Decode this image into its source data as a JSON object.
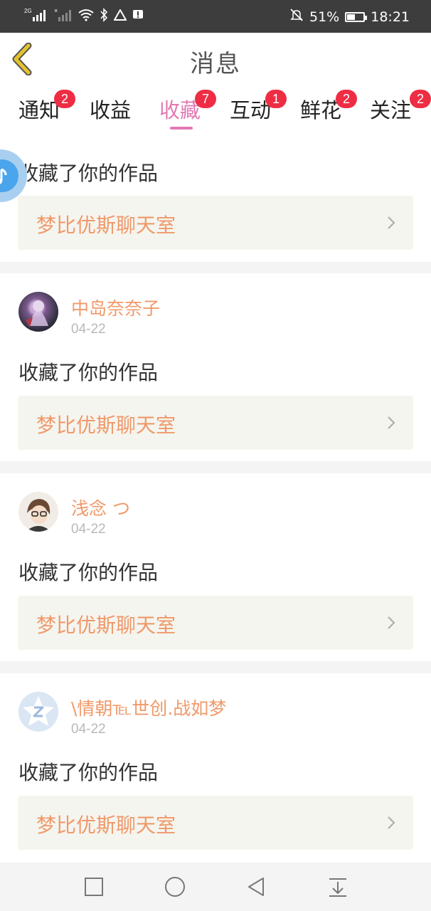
{
  "status_bar": {
    "signal_2g": "2G",
    "signal_x": "×",
    "battery_percent": "51%",
    "battery_level": 0.51,
    "time": "18:21"
  },
  "header": {
    "title": "消息"
  },
  "tabs": [
    {
      "label": "通知",
      "badge": "2"
    },
    {
      "label": "收益",
      "badge": ""
    },
    {
      "label": "收藏",
      "badge": "7",
      "active": true
    },
    {
      "label": "互动",
      "badge": "1"
    },
    {
      "label": "鲜花",
      "badge": "2"
    },
    {
      "label": "关注",
      "badge": "2"
    }
  ],
  "items": [
    {
      "message": "收藏了你的作品",
      "link": "梦比优斯聊天室"
    },
    {
      "user": "中岛奈奈子",
      "date": "04-22",
      "message": "收藏了你的作品",
      "link": "梦比优斯聊天室"
    },
    {
      "user": "浅念 つ",
      "date": "04-22",
      "message": "收藏了你的作品",
      "link": "梦比优斯聊天室"
    },
    {
      "user": "\\情朝℡世创.战如梦",
      "date": "04-22",
      "message": "收藏了你的作品",
      "link": "梦比优斯聊天室"
    }
  ],
  "colors": {
    "accent": "#e27ab4",
    "username": "#f0996a",
    "badge": "#ee2d44",
    "back_arrow": "#d4aa1a"
  },
  "icons": {
    "back": "chevron-left-icon",
    "floating": "music-note-icon",
    "nav": [
      "square-icon",
      "circle-icon",
      "triangle-back-icon",
      "download-icon"
    ]
  }
}
